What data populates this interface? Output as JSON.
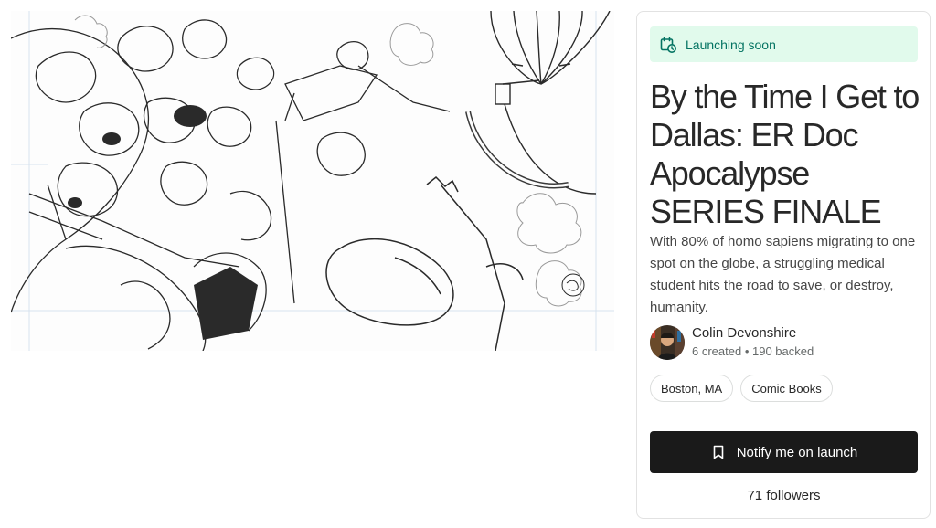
{
  "project": {
    "status_label": "Launching soon",
    "title": "By the Time I Get to Dallas: ER Doc Apocalypse SERIES FINALE",
    "blurb": "With 80% of homo sapiens migrating to one spot on the globe, a struggling medical student hits the road to save, or destroy, humanity.",
    "creator": {
      "name": "Colin Devonshire",
      "created": "6 created",
      "backed": "190 backed"
    },
    "tags": [
      "Boston, MA",
      "Comic Books"
    ],
    "notify_label": "Notify me on launch",
    "followers": "71 followers"
  },
  "icons": {
    "status": "calendar-clock-icon",
    "notify": "bookmark-icon"
  },
  "colors": {
    "badge_bg": "#e1faec",
    "badge_text": "#037362",
    "button_bg": "#1a1a1a"
  }
}
